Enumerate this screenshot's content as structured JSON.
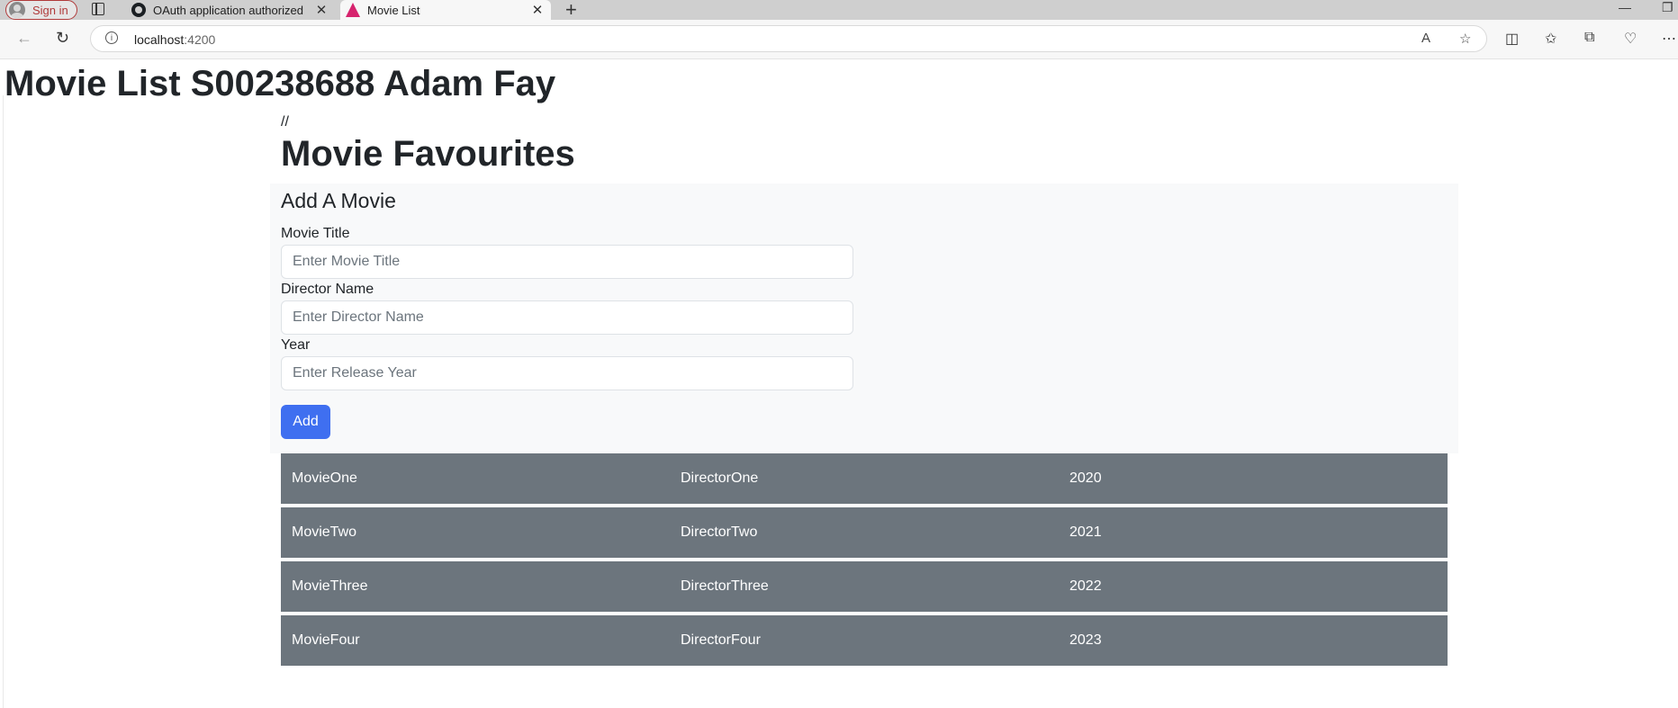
{
  "browser": {
    "signin_label": "Sign in",
    "tabs": [
      {
        "title": "OAuth application authorized",
        "close": "✕"
      },
      {
        "title": "Movie List",
        "close": "✕"
      }
    ],
    "new_tab": "+",
    "window_controls": {
      "minimize": "—",
      "restore": "❐"
    },
    "address": {
      "host": "localhost",
      "port": ":4200"
    },
    "icons": {
      "back": "←",
      "reload": "↻",
      "info": "i",
      "read_aloud": "A",
      "favorite": "☆",
      "split": "◫",
      "favorites": "✩",
      "collections": "⧉",
      "extensions": "♡",
      "more": "⋯"
    }
  },
  "page": {
    "app_title": "Movie List S00238688 Adam Fay",
    "comment": "//",
    "section_title": "Movie Favourites"
  },
  "form": {
    "heading": "Add A Movie",
    "fields": [
      {
        "label": "Movie Title",
        "placeholder": "Enter Movie Title"
      },
      {
        "label": "Director Name",
        "placeholder": "Enter Director Name"
      },
      {
        "label": "Year",
        "placeholder": "Enter Release Year"
      }
    ],
    "submit_label": "Add"
  },
  "movies": [
    {
      "title": "MovieOne",
      "director": "DirectorOne",
      "year": "2020"
    },
    {
      "title": "MovieTwo",
      "director": "DirectorTwo",
      "year": "2021"
    },
    {
      "title": "MovieThree",
      "director": "DirectorThree",
      "year": "2022"
    },
    {
      "title": "MovieFour",
      "director": "DirectorFour",
      "year": "2023"
    }
  ],
  "colors": {
    "primary_button": "#3f6ff0",
    "row_background": "#6c757d",
    "panel_background": "#f8f9fa"
  }
}
